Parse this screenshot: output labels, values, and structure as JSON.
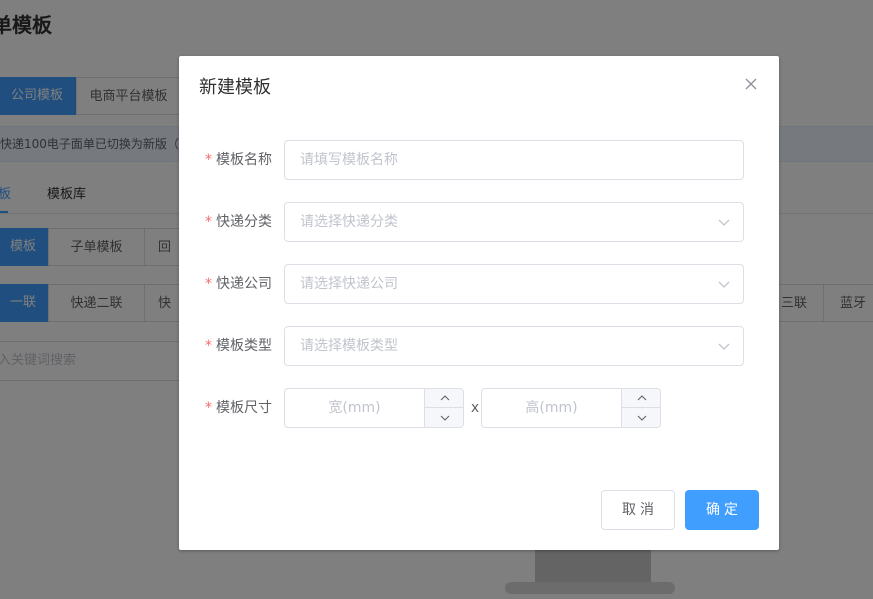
{
  "background": {
    "page_title": "单模板",
    "tabs": [
      "公司模板",
      "电商平台模板"
    ],
    "notice": "快递100电子面单已切换为新版（",
    "sub_tabs": [
      "板",
      "模板库"
    ],
    "type_tabs": [
      "模板",
      "子单模板",
      "回"
    ],
    "copy_tabs": [
      "一联",
      "快递二联",
      "快",
      "三联",
      "蓝牙"
    ],
    "search_placeholder": "入关键词搜索"
  },
  "dialog": {
    "title": "新建模板",
    "fields": {
      "name": {
        "label": "模板名称",
        "placeholder": "请填写模板名称"
      },
      "category": {
        "label": "快递分类",
        "placeholder": "请选择快递分类"
      },
      "company": {
        "label": "快递公司",
        "placeholder": "请选择快递公司"
      },
      "type": {
        "label": "模板类型",
        "placeholder": "请选择模板类型"
      },
      "size": {
        "label": "模板尺寸",
        "width_placeholder": "宽(mm)",
        "height_placeholder": "高(mm)",
        "separator": "x"
      }
    },
    "required_mark": "*",
    "cancel_label": "取消",
    "confirm_label": "确定"
  },
  "colors": {
    "primary": "#409eff",
    "required": "#f56c6c",
    "overlay": "rgba(0,0,0,0.5)"
  },
  "icons": {
    "close": "close-icon",
    "select_arrow": "chevron-down-icon",
    "increase": "chevron-up-icon",
    "decrease": "chevron-down-icon"
  }
}
